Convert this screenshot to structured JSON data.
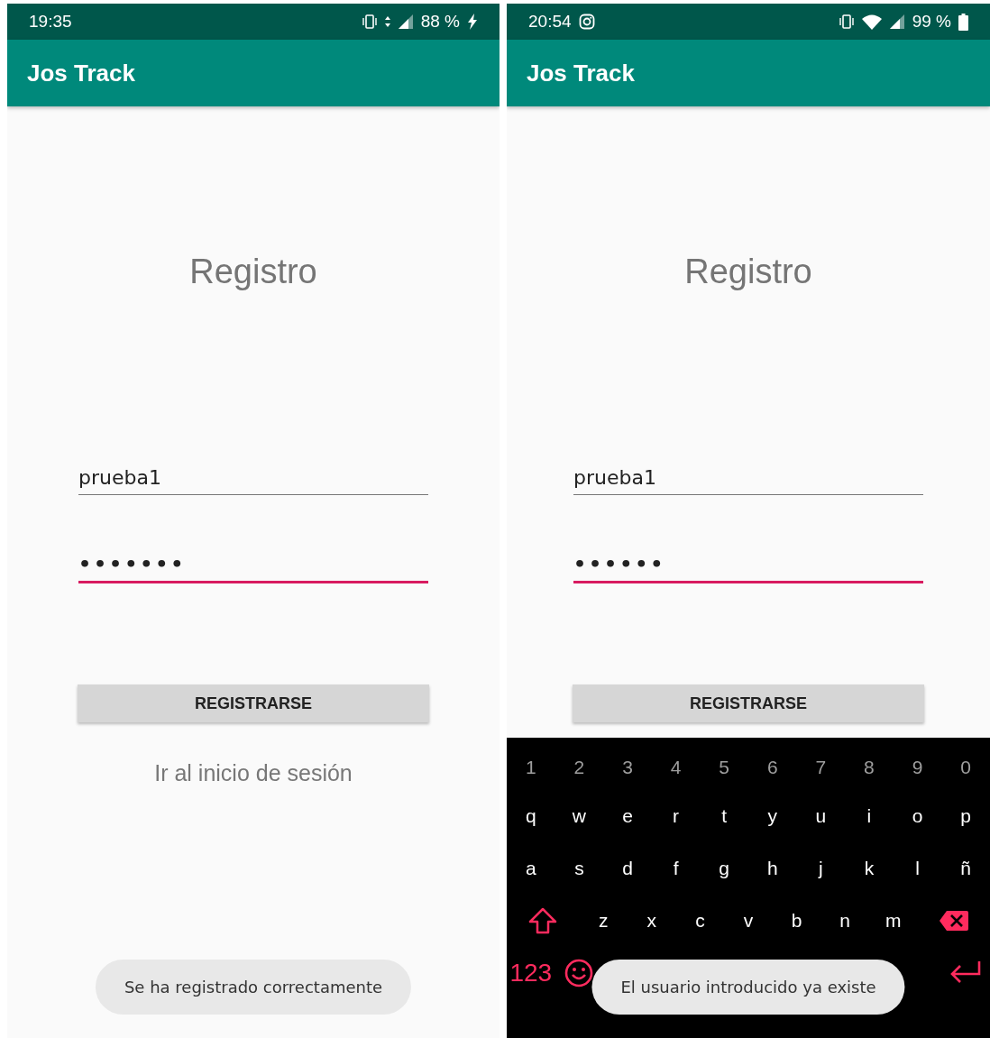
{
  "screens": [
    {
      "status_bar": {
        "time": "19:35",
        "right_icons": [
          {
            "kind": "vibrate"
          },
          {
            "kind": "mobile-data"
          },
          {
            "kind": "signal"
          }
        ],
        "battery": "88 %",
        "battery_icon": {
          "kind": "charging"
        }
      },
      "app_bar": {
        "title": "Jos Track"
      },
      "heading": "Registro",
      "fields": [
        {
          "kind": "text",
          "value": "prueba1",
          "focused": false
        },
        {
          "kind": "password",
          "value": "•••••••",
          "focused": true
        }
      ],
      "button": "REGISTRARSE",
      "link": "Ir al inicio de sesión",
      "toast": "Se ha registrado correctamente"
    },
    {
      "status_bar": {
        "time": "20:54",
        "left_icons": [
          {
            "kind": "camera"
          }
        ],
        "right_icons": [
          {
            "kind": "vibrate"
          },
          {
            "kind": "wifi"
          },
          {
            "kind": "signal"
          }
        ],
        "battery": "99 %",
        "battery_icon": {
          "kind": "battery"
        }
      },
      "app_bar": {
        "title": "Jos Track"
      },
      "heading": "Registro",
      "fields": [
        {
          "kind": "text",
          "value": "prueba1",
          "focused": false
        },
        {
          "kind": "password",
          "value": "••••••",
          "focused": true
        }
      ],
      "button": "REGISTRARSE",
      "keyboard": {
        "rows": [
          {
            "kind": "digits",
            "keys": [
              {
                "kind": "char",
                "label": "1"
              },
              {
                "kind": "char",
                "label": "2"
              },
              {
                "kind": "char",
                "label": "3"
              },
              {
                "kind": "char",
                "label": "4"
              },
              {
                "kind": "char",
                "label": "5"
              },
              {
                "kind": "char",
                "label": "6"
              },
              {
                "kind": "char",
                "label": "7"
              },
              {
                "kind": "char",
                "label": "8"
              },
              {
                "kind": "char",
                "label": "9"
              },
              {
                "kind": "char",
                "label": "0"
              }
            ]
          },
          {
            "kind": "letters",
            "keys": [
              {
                "kind": "char",
                "label": "q"
              },
              {
                "kind": "char",
                "label": "w"
              },
              {
                "kind": "char",
                "label": "e"
              },
              {
                "kind": "char",
                "label": "r"
              },
              {
                "kind": "char",
                "label": "t"
              },
              {
                "kind": "char",
                "label": "y"
              },
              {
                "kind": "char",
                "label": "u"
              },
              {
                "kind": "char",
                "label": "i"
              },
              {
                "kind": "char",
                "label": "o"
              },
              {
                "kind": "char",
                "label": "p"
              }
            ]
          },
          {
            "kind": "letters",
            "keys": [
              {
                "kind": "char",
                "label": "a"
              },
              {
                "kind": "char",
                "label": "s"
              },
              {
                "kind": "char",
                "label": "d"
              },
              {
                "kind": "char",
                "label": "f"
              },
              {
                "kind": "char",
                "label": "g"
              },
              {
                "kind": "char",
                "label": "h"
              },
              {
                "kind": "char",
                "label": "j"
              },
              {
                "kind": "char",
                "label": "k"
              },
              {
                "kind": "char",
                "label": "l"
              },
              {
                "kind": "char",
                "label": "ñ"
              }
            ]
          },
          {
            "kind": "letters",
            "keys": [
              {
                "kind": "shift"
              },
              {
                "kind": "char",
                "label": "z"
              },
              {
                "kind": "char",
                "label": "x"
              },
              {
                "kind": "char",
                "label": "c"
              },
              {
                "kind": "char",
                "label": "v"
              },
              {
                "kind": "char",
                "label": "b"
              },
              {
                "kind": "char",
                "label": "n"
              },
              {
                "kind": "char",
                "label": "m"
              },
              {
                "kind": "backspace"
              }
            ]
          },
          {
            "kind": "bottom",
            "keys": [
              {
                "kind": "mode",
                "label": "123"
              },
              {
                "kind": "emoji"
              },
              {
                "kind": "space"
              },
              {
                "kind": "enter"
              }
            ]
          }
        ]
      },
      "toast": "El usuario introducido ya existe"
    }
  ]
}
